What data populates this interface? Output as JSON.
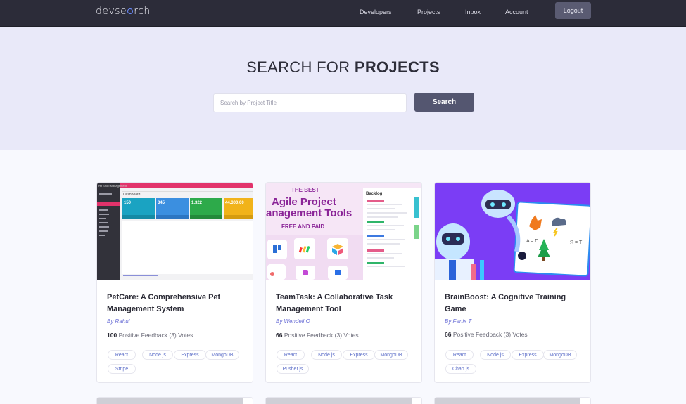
{
  "nav": {
    "logo_left": "devse",
    "logo_right": "rch",
    "links": [
      "Developers",
      "Projects",
      "Inbox",
      "Account"
    ],
    "logout": "Logout"
  },
  "hero": {
    "title_light": "SEARCH FOR",
    "title_bold": "PROJECTS",
    "search_placeholder": "Search by Project Title",
    "search_button": "Search"
  },
  "projects": [
    {
      "title": "PetCare: A Comprehensive Pet Management System",
      "author": "By Rahul",
      "votes_pct": "100",
      "votes_text": "Positive Feedback (3) Votes",
      "tags": [
        "React",
        "Node.js",
        "Express",
        "MongoDB",
        "Stripe"
      ],
      "thumb": {
        "sidebar_title": "Pet Shop Management",
        "heading": "Dashboard",
        "stats": [
          "150",
          "345",
          "1,322",
          "44,300.00"
        ]
      }
    },
    {
      "title": "TeamTask: A Collaborative Task Management Tool",
      "author": "By Wendell O",
      "votes_pct": "66",
      "votes_text": "Positive Feedback (3) Votes",
      "tags": [
        "React",
        "Node.js",
        "Express",
        "MongoDB",
        "Pusher.js"
      ],
      "thumb": {
        "kicker": "THE BEST",
        "line1": "Agile Project",
        "line2": "anagement Tools",
        "sub": "FREE AND PAID",
        "panel": "Backlog"
      }
    },
    {
      "title": "BrainBoost: A Cognitive Training Game",
      "author": "By Fenix T",
      "votes_pct": "66",
      "votes_text": "Positive Feedback (3) Votes",
      "tags": [
        "React",
        "Node.js",
        "Express",
        "MongoDB",
        "Chart.js"
      ],
      "thumb": {
        "eq1": "A = П",
        "eq2": "Я = Т"
      }
    }
  ]
}
